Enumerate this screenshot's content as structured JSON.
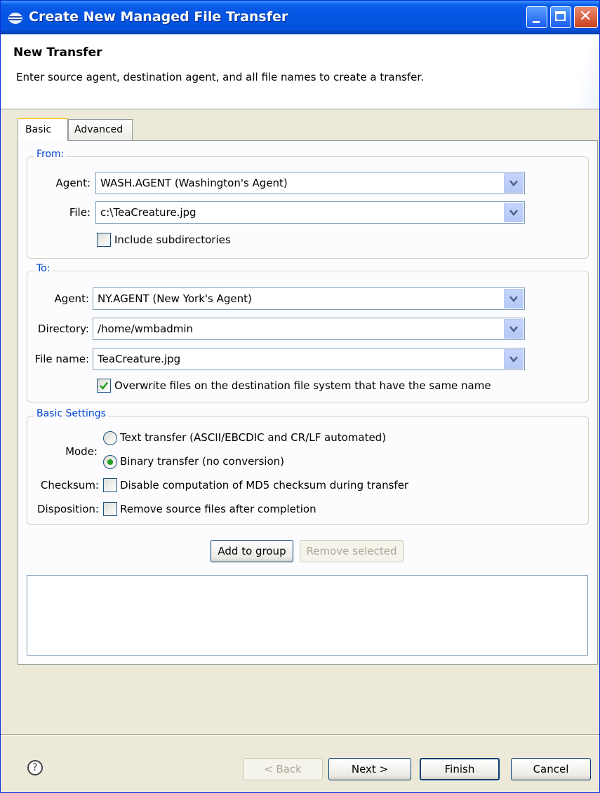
{
  "window": {
    "title": "Create New Managed File Transfer"
  },
  "header": {
    "title": "New Transfer",
    "description": "Enter source agent, destination agent, and all file names to create a transfer."
  },
  "tabs": [
    {
      "label": "Basic",
      "selected": true
    },
    {
      "label": "Advanced",
      "selected": false
    }
  ],
  "from": {
    "legend": "From:",
    "agent_label": "Agent:",
    "agent_value": "WASH.AGENT (Washington's Agent)",
    "file_label": "File:",
    "file_value": "c:\\TeaCreature.jpg",
    "include_subdirs_label": "Include subdirectories",
    "include_subdirs_checked": false
  },
  "to": {
    "legend": "To:",
    "agent_label": "Agent:",
    "agent_value": "NY.AGENT (New York's Agent)",
    "directory_label": "Directory:",
    "directory_value": "/home/wmbadmin",
    "filename_label": "File name:",
    "filename_value": "TeaCreature.jpg",
    "overwrite_label": "Overwrite files on the destination file system that have the same name",
    "overwrite_checked": true
  },
  "settings": {
    "legend": "Basic Settings",
    "mode_label": "Mode:",
    "mode_text": "Text transfer (ASCII/EBCDIC and CR/LF automated)",
    "mode_binary": "Binary transfer (no conversion)",
    "mode_selected": "binary",
    "checksum_label": "Checksum:",
    "checksum_text": "Disable computation of MD5 checksum during transfer",
    "disposition_label": "Disposition:",
    "disposition_text": "Remove source files after completion"
  },
  "group_buttons": {
    "add": "Add to group",
    "remove": "Remove selected"
  },
  "footer": {
    "back": "< Back",
    "next": "Next >",
    "finish": "Finish",
    "cancel": "Cancel",
    "help": "?"
  },
  "colors": {
    "titlebar": "#0554e3",
    "legend": "#0046d5",
    "check": "#21a121"
  }
}
